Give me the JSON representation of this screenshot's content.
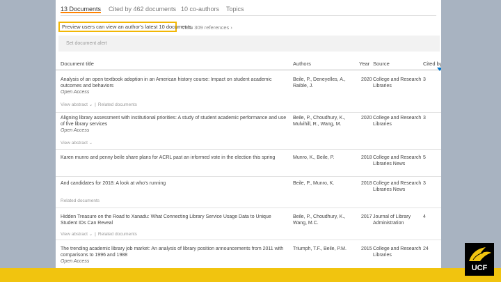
{
  "tabs": [
    {
      "label": "13 Documents"
    },
    {
      "label": "Cited by 462 documents"
    },
    {
      "label": "10 co-authors"
    },
    {
      "label": "Topics"
    }
  ],
  "preview_notice": "Preview users can view an author's latest 10 documents.",
  "view_refs_label": "View 309 references",
  "alert_label": "Set document alert",
  "columns": {
    "title": "Document title",
    "authors": "Authors",
    "year": "Year",
    "source": "Source",
    "cited": "Cited by"
  },
  "sublinks": {
    "view_abstract": "View abstract",
    "related": "Related documents",
    "sep": "|"
  },
  "documents": [
    {
      "title": "Analysis of an open textbook adoption in an American history course: Impact on student academic outcomes and behaviors",
      "access": "Open Access",
      "authors": "Beile, P., Deneyelles, A., Raible, J.",
      "year": "2020",
      "source": "College and Research Libraries",
      "cited": "3"
    },
    {
      "title": "Aligning library assessment with institutional priorities: A study of student academic performance and use of five library services",
      "access": "Open Access",
      "authors": "Beile, P., Choudhury, K., Mulvihill, R., Wang, M.",
      "year": "2020",
      "source": "College and Research Libraries",
      "cited": "3"
    },
    {
      "title": "Karen munro and penny beile share plans for ACRL past an informed vote in the election this spring",
      "authors": "Munro, K., Beile, P.",
      "year": "2018",
      "source": "College and Research Libraries News",
      "cited": "5"
    },
    {
      "title": "And candidates for 2018: A look at who's running",
      "authors": "Beile, P., Munro, K.",
      "year": "2018",
      "source": "College and Research Libraries News",
      "cited": "3"
    },
    {
      "title": "Hidden Treasure on the Road to Xanadu: What Connecting Library Service Usage Data to Unique Student IDs Can Reveal",
      "authors": "Beile, P., Choudhury, K., Wang, M.C.",
      "year": "2017",
      "source": "Journal of Library Administration",
      "cited": "4"
    },
    {
      "title": "The trending academic library job market: An analysis of library position announcements from 2011 with comparisons to 1996 and 1988",
      "access": "Open Access",
      "authors": "Triumph, T.F., Beile, P.M.",
      "year": "2015",
      "source": "College and Research Libraries",
      "cited": "24"
    }
  ],
  "logo_text": "UCF",
  "colors": {
    "background": "#a8b3c1",
    "highlight_border": "#f2b705",
    "gold_bar": "#f1c40f",
    "tab_accent": "#ff8200",
    "link_blue": "#0073c7"
  }
}
